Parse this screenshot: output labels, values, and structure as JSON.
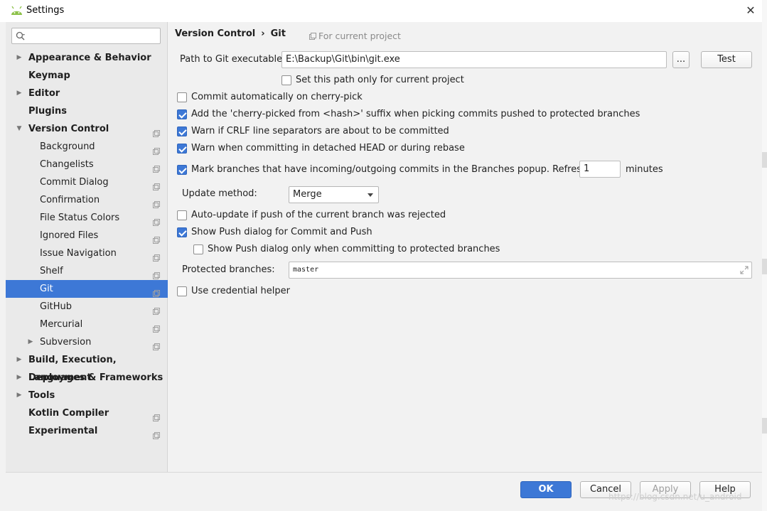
{
  "window": {
    "title": "Settings",
    "close": "✕"
  },
  "sidebar": {
    "search_placeholder": "",
    "items": [
      {
        "label": "Appearance & Behavior",
        "bold": true,
        "arrow": "▶",
        "indent": 0,
        "proj": false
      },
      {
        "label": "Keymap",
        "bold": true,
        "arrow": "",
        "indent": 0,
        "proj": false
      },
      {
        "label": "Editor",
        "bold": true,
        "arrow": "▶",
        "indent": 0,
        "proj": false
      },
      {
        "label": "Plugins",
        "bold": true,
        "arrow": "",
        "indent": 0,
        "proj": false
      },
      {
        "label": "Version Control",
        "bold": true,
        "arrow": "▼",
        "indent": 0,
        "proj": true
      },
      {
        "label": "Background",
        "bold": false,
        "arrow": "",
        "indent": 1,
        "proj": true
      },
      {
        "label": "Changelists",
        "bold": false,
        "arrow": "",
        "indent": 1,
        "proj": true
      },
      {
        "label": "Commit Dialog",
        "bold": false,
        "arrow": "",
        "indent": 1,
        "proj": true
      },
      {
        "label": "Confirmation",
        "bold": false,
        "arrow": "",
        "indent": 1,
        "proj": true
      },
      {
        "label": "File Status Colors",
        "bold": false,
        "arrow": "",
        "indent": 1,
        "proj": true
      },
      {
        "label": "Ignored Files",
        "bold": false,
        "arrow": "",
        "indent": 1,
        "proj": true
      },
      {
        "label": "Issue Navigation",
        "bold": false,
        "arrow": "",
        "indent": 1,
        "proj": true
      },
      {
        "label": "Shelf",
        "bold": false,
        "arrow": "",
        "indent": 1,
        "proj": true
      },
      {
        "label": "Git",
        "bold": false,
        "arrow": "",
        "indent": 1,
        "proj": true,
        "selected": true
      },
      {
        "label": "GitHub",
        "bold": false,
        "arrow": "",
        "indent": 1,
        "proj": true
      },
      {
        "label": "Mercurial",
        "bold": false,
        "arrow": "",
        "indent": 1,
        "proj": true
      },
      {
        "label": "Subversion",
        "bold": false,
        "arrow": "▶",
        "indent": 1,
        "proj": true
      },
      {
        "label": "Build, Execution, Deployment",
        "bold": true,
        "arrow": "▶",
        "indent": 0,
        "proj": false
      },
      {
        "label": "Languages & Frameworks",
        "bold": true,
        "arrow": "▶",
        "indent": 0,
        "proj": false
      },
      {
        "label": "Tools",
        "bold": true,
        "arrow": "▶",
        "indent": 0,
        "proj": false
      },
      {
        "label": "Kotlin Compiler",
        "bold": true,
        "arrow": "",
        "indent": 0,
        "proj": true
      },
      {
        "label": "Experimental",
        "bold": true,
        "arrow": "",
        "indent": 0,
        "proj": true
      }
    ]
  },
  "main": {
    "breadcrumb": {
      "parent": "Version Control",
      "separator": "›",
      "current": "Git"
    },
    "for_current_project": "For current project",
    "path_label": "Path to Git executable:",
    "path_value": "E:\\Backup\\Git\\bin\\git.exe",
    "browse_label": "...",
    "test_label": "Test",
    "set_path_only": {
      "label": "Set this path only for current project",
      "checked": false
    },
    "options": [
      {
        "label": "Commit automatically on cherry-pick",
        "checked": false
      },
      {
        "label": "Add the 'cherry-picked from <hash>' suffix when picking commits pushed to protected branches",
        "checked": true
      },
      {
        "label": "Warn if CRLF line separators are about to be committed",
        "checked": true
      },
      {
        "label": "Warn when committing in detached HEAD or during rebase",
        "checked": true
      }
    ],
    "mark_branches": {
      "label": "Mark branches that have incoming/outgoing commits in the Branches popup.  Refresh every",
      "checked": true
    },
    "refresh_value": "1",
    "minutes_label": "minutes",
    "update_method_label": "Update method:",
    "update_method_value": "Merge",
    "auto_update": {
      "label": "Auto-update if push of the current branch was rejected",
      "checked": false
    },
    "show_push": {
      "label": "Show Push dialog for Commit and Push",
      "checked": true
    },
    "show_push_protected": {
      "label": "Show Push dialog only when committing to protected branches",
      "checked": false
    },
    "protected_label": "Protected branches:",
    "protected_value": "master",
    "credential_helper": {
      "label": "Use credential helper",
      "checked": false
    }
  },
  "footer": {
    "ok": "OK",
    "cancel": "Cancel",
    "apply": "Apply",
    "help": "Help"
  },
  "watermark": "https://blog.csdn.net/u_android",
  "edge_chars": [
    "3",
    "2"
  ],
  "colors": {
    "accent": "#3d78d6",
    "selected_row": "#3d78d6"
  }
}
